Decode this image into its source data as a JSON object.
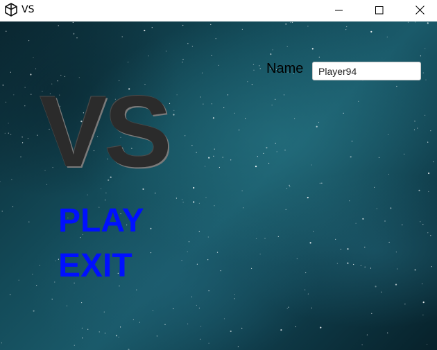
{
  "window": {
    "title": "VS",
    "icon": "unity-logo-icon",
    "controls": {
      "minimize_icon": "minimize-icon",
      "maximize_icon": "maximize-icon",
      "close_icon": "close-icon"
    }
  },
  "game": {
    "logo_text": "VS",
    "menu": {
      "play_label": "PLAY",
      "exit_label": "EXIT"
    },
    "name_field": {
      "label": "Name",
      "value": "Player94"
    }
  },
  "colors": {
    "menu_text": "#0010ff",
    "logo_text": "#2b2b2b",
    "background": "#134a58"
  }
}
